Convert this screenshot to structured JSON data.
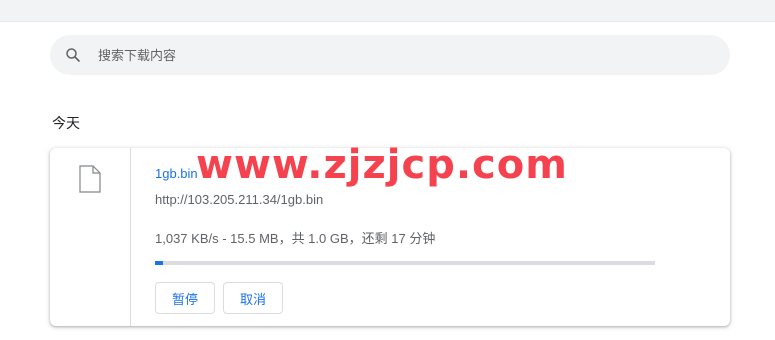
{
  "search": {
    "placeholder": "搜索下载内容",
    "icon": "search-icon"
  },
  "section": {
    "date_label": "今天"
  },
  "download": {
    "file_name": "1gb.bin",
    "url": "http://103.205.211.34/1gb.bin",
    "progress_text": "1,037 KB/s - 15.5 MB，共 1.0 GB，还剩 17 分钟",
    "progress_fraction": 0.0155,
    "file_icon": "file-icon",
    "buttons": {
      "pause": "暂停",
      "cancel": "取消"
    }
  },
  "watermark": {
    "text": "www.zjzjcp.com"
  },
  "colors": {
    "accent": "#1a73e8",
    "watermark": "#f5424f",
    "search_bg": "#f1f3f4"
  }
}
